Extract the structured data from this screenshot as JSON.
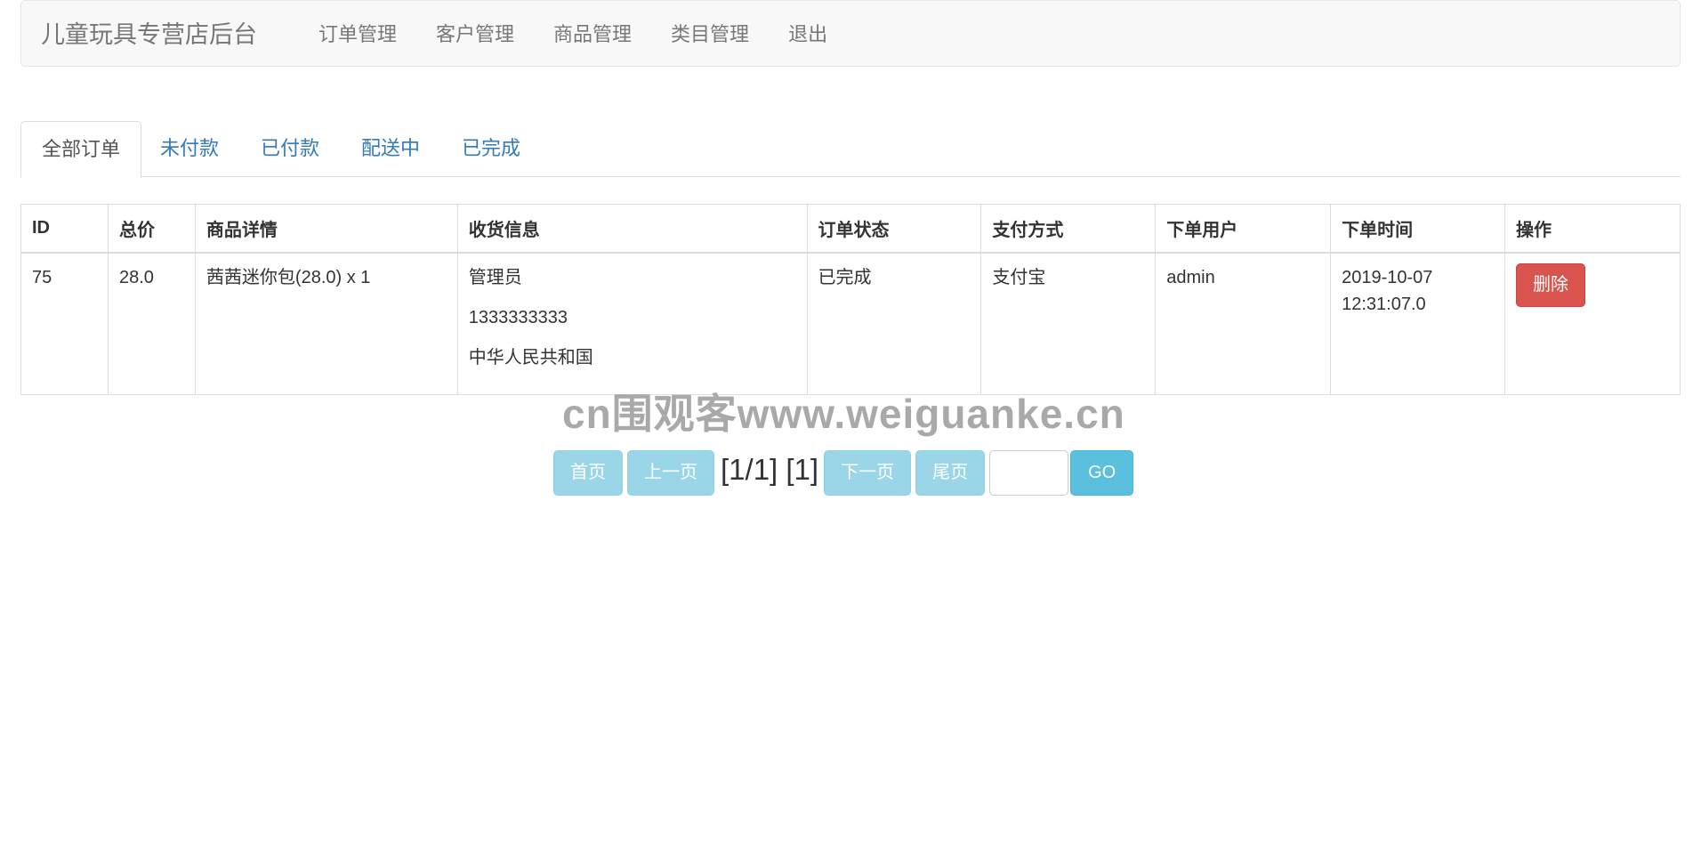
{
  "navbar": {
    "brand": "儿童玩具专营店后台",
    "links": [
      "订单管理",
      "客户管理",
      "商品管理",
      "类目管理",
      "退出"
    ]
  },
  "tabs": [
    "全部订单",
    "未付款",
    "已付款",
    "配送中",
    "已完成"
  ],
  "table": {
    "headers": [
      "ID",
      "总价",
      "商品详情",
      "收货信息",
      "订单状态",
      "支付方式",
      "下单用户",
      "下单时间",
      "操作"
    ],
    "rows": [
      {
        "id": "75",
        "total": "28.0",
        "items": "茜茜迷你包(28.0) x 1",
        "shipping": [
          "管理员",
          "1333333333",
          "中华人民共和国"
        ],
        "status": "已完成",
        "payment": "支付宝",
        "user": "admin",
        "time": "2019-10-07 12:31:07.0",
        "action": "删除"
      }
    ]
  },
  "watermark": "cn围观客www.weiguanke.cn",
  "pagination": {
    "first": "首页",
    "prev": "上一页",
    "info": "[1/1] [1]",
    "next": "下一页",
    "last": "尾页",
    "input_value": "",
    "go": "GO"
  },
  "colors": {
    "navbar_bg": "#f8f8f8",
    "link": "#337ab7",
    "danger": "#d9534f",
    "info": "#5bc0de",
    "info_disabled": "#9bd6e8"
  }
}
